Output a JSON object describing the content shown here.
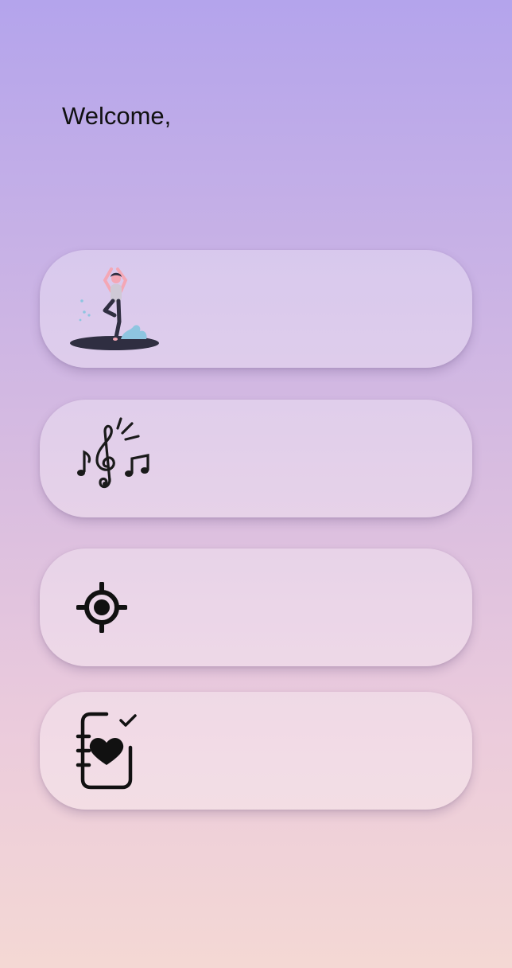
{
  "greeting": "Welcome,",
  "cards": [
    {
      "icon": "yoga-meditation-icon"
    },
    {
      "icon": "music-notes-icon"
    },
    {
      "icon": "location-target-icon"
    },
    {
      "icon": "health-journal-icon"
    }
  ]
}
